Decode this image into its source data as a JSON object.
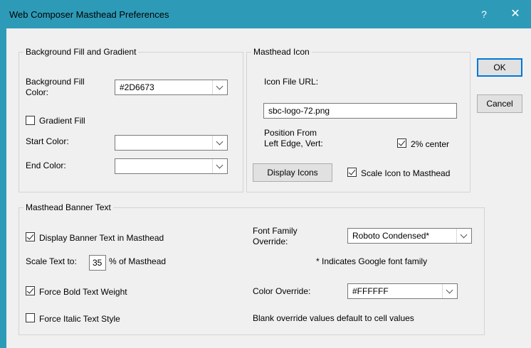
{
  "window": {
    "title": "Web Composer Masthead Preferences",
    "help_glyph": "?",
    "close_glyph": "✕"
  },
  "buttons": {
    "ok": "OK",
    "cancel": "Cancel"
  },
  "background_group": {
    "legend": "Background Fill and Gradient",
    "fill_color_label_1": "Background Fill",
    "fill_color_label_2": "Color:",
    "fill_color_value": "#2D6673",
    "gradient_fill_label": "Gradient Fill",
    "gradient_fill_checked": false,
    "start_color_label": "Start Color:",
    "start_color_value": "",
    "end_color_label": "End Color:",
    "end_color_value": ""
  },
  "icon_group": {
    "legend": "Masthead Icon",
    "icon_url_label": "Icon File URL:",
    "icon_url_value": "sbc-logo-72.png",
    "position_label_1": "Position From",
    "position_label_2": "Left Edge, Vert:",
    "center_label": "2% center",
    "center_checked": true,
    "display_icons_button": "Display Icons",
    "scale_icon_label": "Scale Icon to Masthead",
    "scale_icon_checked": true
  },
  "banner_group": {
    "legend": "Masthead Banner Text",
    "display_banner_label": "Display Banner Text in Masthead",
    "display_banner_checked": true,
    "scale_text_label": "Scale Text to:",
    "scale_text_value": "35",
    "scale_text_suffix": "% of Masthead",
    "force_bold_label": "Force Bold Text Weight",
    "force_bold_checked": true,
    "force_italic_label": "Force Italic Text Style",
    "force_italic_checked": false,
    "font_family_label_1": "Font Family",
    "font_family_label_2": "Override:",
    "font_family_value": "Roboto Condensed*",
    "google_note": "* Indicates Google font family",
    "color_override_label": "Color Override:",
    "color_override_value": "#FFFFFF",
    "blank_note": "Blank override values default to cell values"
  }
}
